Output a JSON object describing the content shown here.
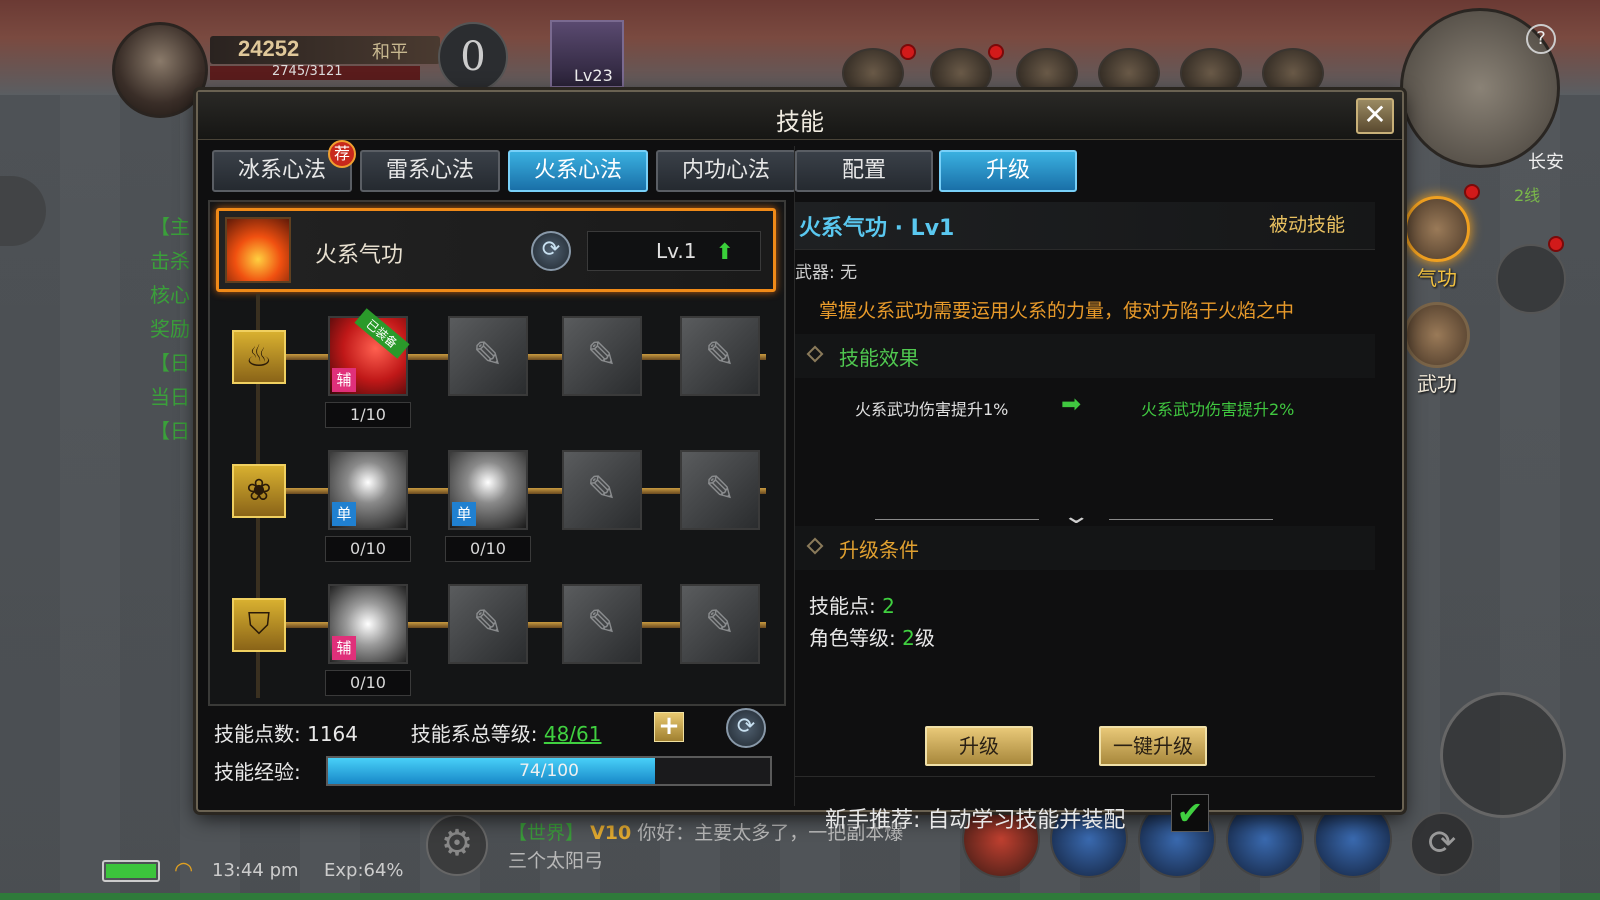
{
  "hud": {
    "power": "24252",
    "peace": "和平",
    "hp": "2745/3121",
    "kill_count": "0",
    "pet_level": "Lv23",
    "city": "长安",
    "line": "2线",
    "help": "?",
    "side_buttons": [
      {
        "label": "气功",
        "icon": "meditation-icon"
      },
      {
        "label": "武功",
        "icon": "martial-book-icon"
      }
    ],
    "chat_channel": "【世界】",
    "chat_vip": "V10",
    "chat_message": "你好：主要太多了，一把副本爆",
    "chat_line2": "三个太阳弓",
    "time": "13:44 pm",
    "exp": "Exp:64%",
    "left_quest_lines": [
      "【主",
      "击杀",
      "核心",
      "奖励",
      "【日",
      "当日",
      "【日"
    ]
  },
  "dialog": {
    "title": "技能",
    "close": "✕",
    "left_tabs": [
      {
        "label": "冰系心法",
        "active": false,
        "badge": "荐"
      },
      {
        "label": "雷系心法",
        "active": false
      },
      {
        "label": "火系心法",
        "active": true
      },
      {
        "label": "内功心法",
        "active": false
      }
    ],
    "selected_skill": {
      "name": "火系气功",
      "level": "Lv.1",
      "refresh": "⟳",
      "up_arrow": "⬆"
    },
    "tree": {
      "rows": [
        {
          "icon": "flame-emblem-icon",
          "glyph": "♨",
          "nodes": [
            {
              "type": "fire",
              "tag": "辅",
              "equipped": "已装备",
              "level": "1/10"
            },
            {
              "type": "locked"
            },
            {
              "type": "locked"
            },
            {
              "type": "locked"
            }
          ]
        },
        {
          "icon": "lotus-emblem-icon",
          "glyph": "❀",
          "nodes": [
            {
              "type": "wind",
              "tag": "单",
              "level": "0/10"
            },
            {
              "type": "wind",
              "tag": "单",
              "level": "0/10"
            },
            {
              "type": "locked"
            },
            {
              "type": "locked"
            }
          ]
        },
        {
          "icon": "shield-emblem-icon",
          "glyph": "⛉",
          "nodes": [
            {
              "type": "burst",
              "tag": "辅",
              "level": "0/10"
            },
            {
              "type": "locked"
            },
            {
              "type": "locked"
            },
            {
              "type": "locked"
            }
          ]
        }
      ]
    },
    "stats": {
      "points_label": "技能点数:",
      "points_value": "1164",
      "total_label": "技能系总等级:",
      "total_value": "48/61",
      "plus": "+",
      "reset": "⟳",
      "exp_label": "技能经验:",
      "exp_text": "74/100",
      "exp_progress": 0.74
    },
    "right_tabs": [
      {
        "label": "配置",
        "active": false
      },
      {
        "label": "升级",
        "active": true
      }
    ],
    "detail": {
      "name": "火系气功 · Lv1",
      "type": "被动技能",
      "weapon": "武器: 无",
      "description": "掌握火系武功需要运用火系的力量，使对方陷于火焰之中",
      "effect_title": "技能效果",
      "effect_current": "火系武功伤害提升1%",
      "effect_arrow": "➡",
      "effect_next": "火系武功伤害提升2%",
      "chevron": "⌄",
      "cond_title": "升级条件",
      "cond_points_label": "技能点:",
      "cond_points_value": "2",
      "cond_level_label": "角色等级:",
      "cond_level_value": "2",
      "cond_level_unit": "级",
      "upgrade_button": "升级",
      "upgrade_all_button": "一键升级",
      "recommend_label": "新手推荐:  自动学习技能并装配",
      "recommend_checked": "✔"
    }
  },
  "colors": {
    "accent_blue": "#1a70a8",
    "highlight_orange": "#f08a18",
    "green_text": "#40d040",
    "gold_text": "#e0a030"
  }
}
